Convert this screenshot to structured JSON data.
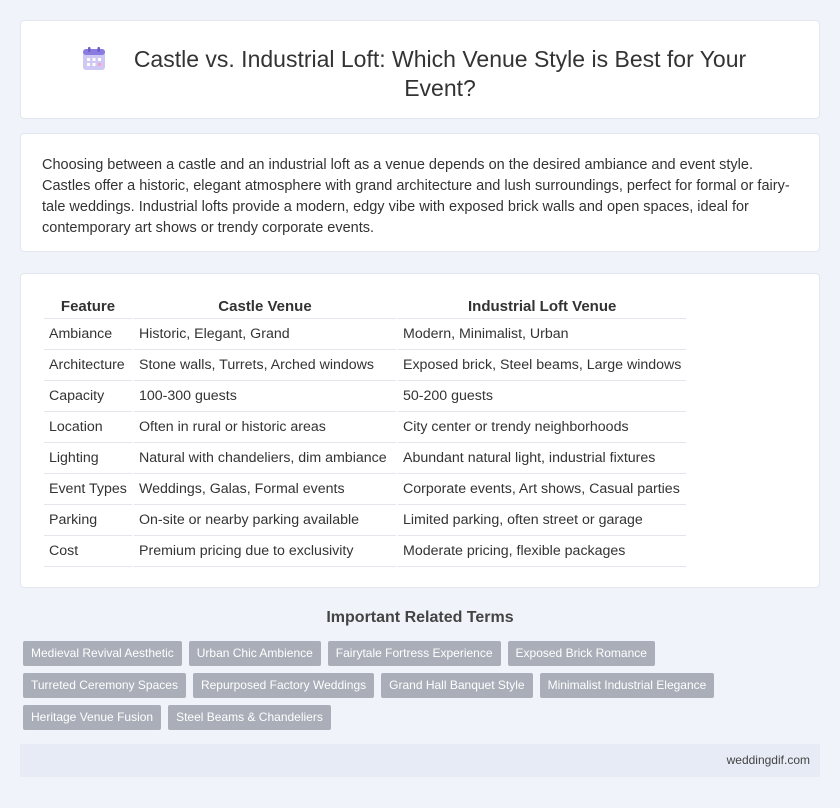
{
  "header": {
    "icon": "calendar-icon",
    "title": "Castle vs. Industrial Loft: Which Venue Style is Best for Your Event?"
  },
  "intro": {
    "text": "Choosing between a castle and an industrial loft as a venue depends on the desired ambiance and event style. Castles offer a historic, elegant atmosphere with grand architecture and lush surroundings, perfect for formal or fairy-tale weddings. Industrial lofts provide a modern, edgy vibe with exposed brick walls and open spaces, ideal for contemporary art shows or trendy corporate events."
  },
  "table": {
    "headers": [
      "Feature",
      "Castle Venue",
      "Industrial Loft Venue"
    ],
    "rows": [
      [
        "Ambiance",
        "Historic, Elegant, Grand",
        "Modern, Minimalist, Urban"
      ],
      [
        "Architecture",
        "Stone walls, Turrets, Arched windows",
        "Exposed brick, Steel beams, Large windows"
      ],
      [
        "Capacity",
        "100-300 guests",
        "50-200 guests"
      ],
      [
        "Location",
        "Often in rural or historic areas",
        "City center or trendy neighborhoods"
      ],
      [
        "Lighting",
        "Natural with chandeliers, dim ambiance",
        "Abundant natural light, industrial fixtures"
      ],
      [
        "Event Types",
        "Weddings, Galas, Formal events",
        "Corporate events, Art shows, Casual parties"
      ],
      [
        "Parking",
        "On-site or nearby parking available",
        "Limited parking, often street or garage"
      ],
      [
        "Cost",
        "Premium pricing due to exclusivity",
        "Moderate pricing, flexible packages"
      ]
    ]
  },
  "related": {
    "heading": "Important Related Terms",
    "terms": [
      "Medieval Revival Aesthetic",
      "Urban Chic Ambience",
      "Fairytale Fortress Experience",
      "Exposed Brick Romance",
      "Turreted Ceremony Spaces",
      "Repurposed Factory Weddings",
      "Grand Hall Banquet Style",
      "Minimalist Industrial Elegance",
      "Heritage Venue Fusion",
      "Steel Beams & Chandeliers"
    ]
  },
  "footer": {
    "site": "weddingdif.com"
  },
  "colors": {
    "page_bg": "#f0f3f9",
    "tag_bg": "#a9aeb8",
    "footer_bg": "#e6ebf5",
    "icon_accent": "#8a7be0"
  }
}
